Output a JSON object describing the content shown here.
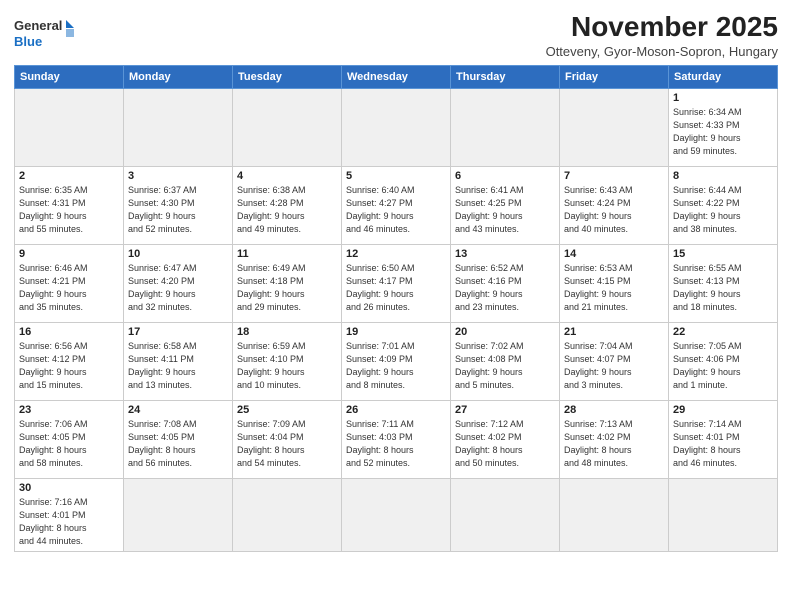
{
  "header": {
    "logo_line1": "General",
    "logo_line2": "Blue",
    "month": "November 2025",
    "location": "Otteveny, Gyor-Moson-Sopron, Hungary"
  },
  "weekdays": [
    "Sunday",
    "Monday",
    "Tuesday",
    "Wednesday",
    "Thursday",
    "Friday",
    "Saturday"
  ],
  "weeks": [
    [
      {
        "day": "",
        "info": ""
      },
      {
        "day": "",
        "info": ""
      },
      {
        "day": "",
        "info": ""
      },
      {
        "day": "",
        "info": ""
      },
      {
        "day": "",
        "info": ""
      },
      {
        "day": "",
        "info": ""
      },
      {
        "day": "1",
        "info": "Sunrise: 6:34 AM\nSunset: 4:33 PM\nDaylight: 9 hours\nand 59 minutes."
      }
    ],
    [
      {
        "day": "2",
        "info": "Sunrise: 6:35 AM\nSunset: 4:31 PM\nDaylight: 9 hours\nand 55 minutes."
      },
      {
        "day": "3",
        "info": "Sunrise: 6:37 AM\nSunset: 4:30 PM\nDaylight: 9 hours\nand 52 minutes."
      },
      {
        "day": "4",
        "info": "Sunrise: 6:38 AM\nSunset: 4:28 PM\nDaylight: 9 hours\nand 49 minutes."
      },
      {
        "day": "5",
        "info": "Sunrise: 6:40 AM\nSunset: 4:27 PM\nDaylight: 9 hours\nand 46 minutes."
      },
      {
        "day": "6",
        "info": "Sunrise: 6:41 AM\nSunset: 4:25 PM\nDaylight: 9 hours\nand 43 minutes."
      },
      {
        "day": "7",
        "info": "Sunrise: 6:43 AM\nSunset: 4:24 PM\nDaylight: 9 hours\nand 40 minutes."
      },
      {
        "day": "8",
        "info": "Sunrise: 6:44 AM\nSunset: 4:22 PM\nDaylight: 9 hours\nand 38 minutes."
      }
    ],
    [
      {
        "day": "9",
        "info": "Sunrise: 6:46 AM\nSunset: 4:21 PM\nDaylight: 9 hours\nand 35 minutes."
      },
      {
        "day": "10",
        "info": "Sunrise: 6:47 AM\nSunset: 4:20 PM\nDaylight: 9 hours\nand 32 minutes."
      },
      {
        "day": "11",
        "info": "Sunrise: 6:49 AM\nSunset: 4:18 PM\nDaylight: 9 hours\nand 29 minutes."
      },
      {
        "day": "12",
        "info": "Sunrise: 6:50 AM\nSunset: 4:17 PM\nDaylight: 9 hours\nand 26 minutes."
      },
      {
        "day": "13",
        "info": "Sunrise: 6:52 AM\nSunset: 4:16 PM\nDaylight: 9 hours\nand 23 minutes."
      },
      {
        "day": "14",
        "info": "Sunrise: 6:53 AM\nSunset: 4:15 PM\nDaylight: 9 hours\nand 21 minutes."
      },
      {
        "day": "15",
        "info": "Sunrise: 6:55 AM\nSunset: 4:13 PM\nDaylight: 9 hours\nand 18 minutes."
      }
    ],
    [
      {
        "day": "16",
        "info": "Sunrise: 6:56 AM\nSunset: 4:12 PM\nDaylight: 9 hours\nand 15 minutes."
      },
      {
        "day": "17",
        "info": "Sunrise: 6:58 AM\nSunset: 4:11 PM\nDaylight: 9 hours\nand 13 minutes."
      },
      {
        "day": "18",
        "info": "Sunrise: 6:59 AM\nSunset: 4:10 PM\nDaylight: 9 hours\nand 10 minutes."
      },
      {
        "day": "19",
        "info": "Sunrise: 7:01 AM\nSunset: 4:09 PM\nDaylight: 9 hours\nand 8 minutes."
      },
      {
        "day": "20",
        "info": "Sunrise: 7:02 AM\nSunset: 4:08 PM\nDaylight: 9 hours\nand 5 minutes."
      },
      {
        "day": "21",
        "info": "Sunrise: 7:04 AM\nSunset: 4:07 PM\nDaylight: 9 hours\nand 3 minutes."
      },
      {
        "day": "22",
        "info": "Sunrise: 7:05 AM\nSunset: 4:06 PM\nDaylight: 9 hours\nand 1 minute."
      }
    ],
    [
      {
        "day": "23",
        "info": "Sunrise: 7:06 AM\nSunset: 4:05 PM\nDaylight: 8 hours\nand 58 minutes."
      },
      {
        "day": "24",
        "info": "Sunrise: 7:08 AM\nSunset: 4:05 PM\nDaylight: 8 hours\nand 56 minutes."
      },
      {
        "day": "25",
        "info": "Sunrise: 7:09 AM\nSunset: 4:04 PM\nDaylight: 8 hours\nand 54 minutes."
      },
      {
        "day": "26",
        "info": "Sunrise: 7:11 AM\nSunset: 4:03 PM\nDaylight: 8 hours\nand 52 minutes."
      },
      {
        "day": "27",
        "info": "Sunrise: 7:12 AM\nSunset: 4:02 PM\nDaylight: 8 hours\nand 50 minutes."
      },
      {
        "day": "28",
        "info": "Sunrise: 7:13 AM\nSunset: 4:02 PM\nDaylight: 8 hours\nand 48 minutes."
      },
      {
        "day": "29",
        "info": "Sunrise: 7:14 AM\nSunset: 4:01 PM\nDaylight: 8 hours\nand 46 minutes."
      }
    ],
    [
      {
        "day": "30",
        "info": "Sunrise: 7:16 AM\nSunset: 4:01 PM\nDaylight: 8 hours\nand 44 minutes."
      },
      {
        "day": "",
        "info": ""
      },
      {
        "day": "",
        "info": ""
      },
      {
        "day": "",
        "info": ""
      },
      {
        "day": "",
        "info": ""
      },
      {
        "day": "",
        "info": ""
      },
      {
        "day": "",
        "info": ""
      }
    ]
  ]
}
